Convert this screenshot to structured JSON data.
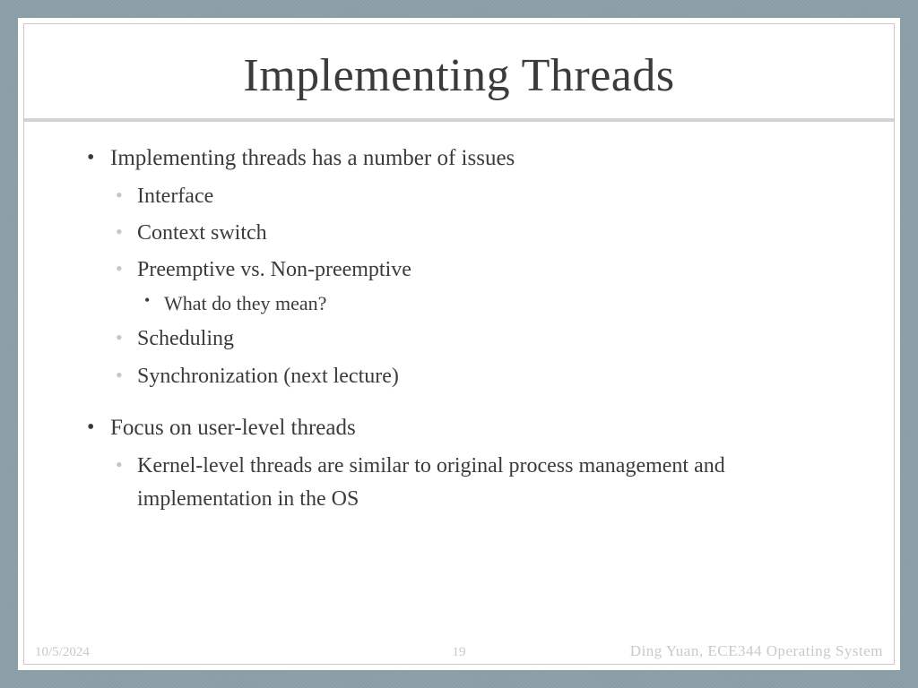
{
  "title": "Implementing Threads",
  "bullets": {
    "b1": "Implementing threads has a number of issues",
    "b1a": "Interface",
    "b1b": "Context switch",
    "b1c": "Preemptive vs. Non-preemptive",
    "b1c1": "What do they mean?",
    "b1d": "Scheduling",
    "b1e": "Synchronization (next lecture)",
    "b2": "Focus on user-level threads",
    "b2a": "Kernel-level threads are similar to original process management and implementation in the OS"
  },
  "footer": {
    "date": "10/5/2024",
    "page": "19",
    "author": "Ding Yuan, ECE344 Operating System"
  }
}
